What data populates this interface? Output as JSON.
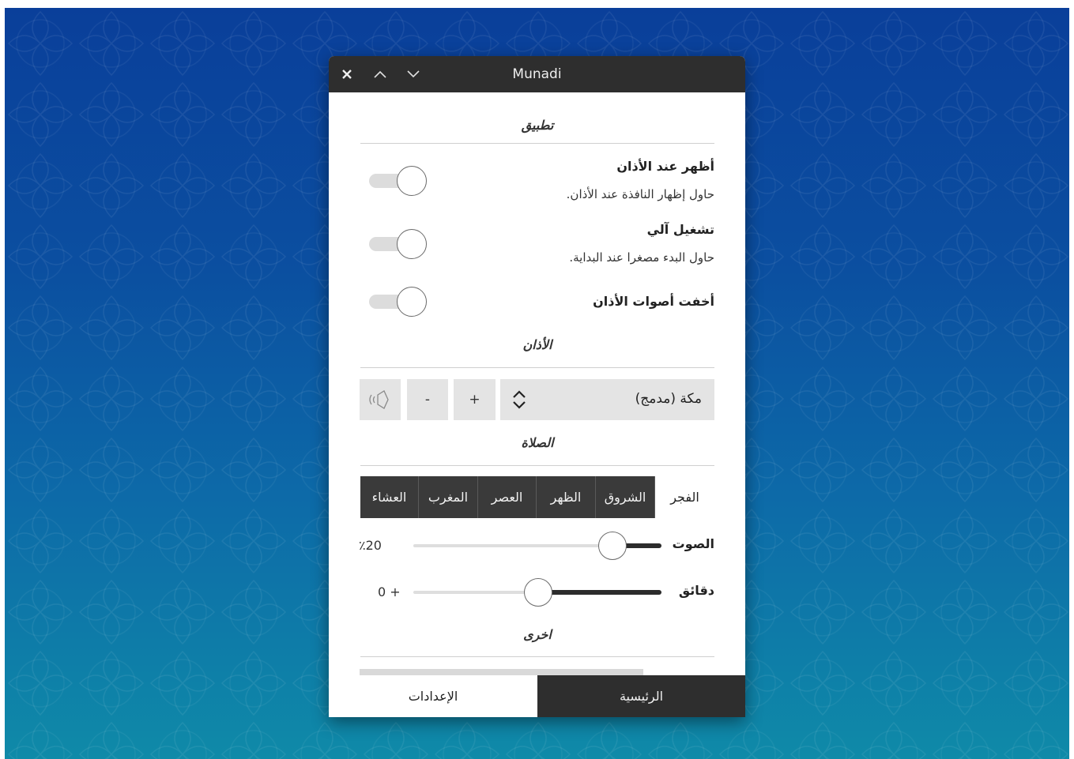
{
  "window": {
    "title": "Munadi",
    "close_icon": "close-icon",
    "up_icon": "chevron-up-icon",
    "down_icon": "chevron-down-icon"
  },
  "sections": {
    "app": "تطبيق",
    "adhan": "الأذان",
    "prayer": "الصلاة",
    "other": "اخرى"
  },
  "settings": [
    {
      "title": "أظهر عند الأذان",
      "subtitle": "حاول إظهار النافذة عند الأذان.",
      "enabled": false
    },
    {
      "title": "تشغيل آلي",
      "subtitle": "حاول البدء مصغرا عند البداية.",
      "enabled": false
    },
    {
      "title": "أخفت أصوات الأذان",
      "subtitle": "",
      "enabled": false
    }
  ],
  "adhan_controls": {
    "selected": "مكة (مدمج)",
    "plus_label": "+",
    "minus_label": "-",
    "select_icon": "up-down-arrows-icon",
    "speaker_icon": "speaker-icon"
  },
  "prayer_tabs": [
    "العشاء",
    "المغرب",
    "العصر",
    "الظهر",
    "الشروق",
    "الفجر"
  ],
  "prayer_active": "الفجر",
  "volume": {
    "label": "الصوت",
    "value_text": "٪20",
    "fraction": 0.2
  },
  "minutes": {
    "label": "دقائق",
    "value_text": "0 +",
    "fraction": 0.5
  },
  "bottom_tabs": {
    "home": "الرئيسية",
    "settings": "الإعدادات",
    "active": "settings"
  },
  "colors": {
    "titlebar": "#2e2e2e",
    "tab_bg": "#3a3a3a",
    "desktop_top": "#0a3f9a",
    "desktop_bottom": "#0f8aa8"
  }
}
